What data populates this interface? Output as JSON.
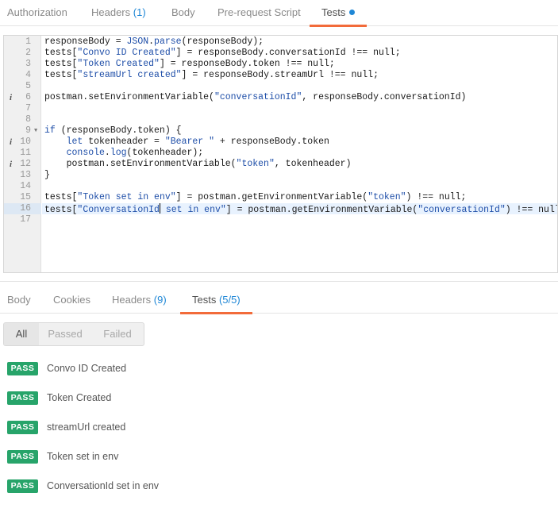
{
  "request_tabs": [
    {
      "label": "Authorization",
      "count": ""
    },
    {
      "label": "Headers",
      "count": "(1)"
    },
    {
      "label": "Body",
      "count": ""
    },
    {
      "label": "Pre-request Script",
      "count": ""
    },
    {
      "label": "Tests",
      "count": "",
      "active": true,
      "modified_dot": true
    }
  ],
  "editor": {
    "lines": [
      {
        "num": "1",
        "info": false,
        "fold": false,
        "text": "responseBody = JSON.parse(responseBody);"
      },
      {
        "num": "2",
        "info": false,
        "fold": false,
        "text": "tests[\"Convo ID Created\"] = responseBody.conversationId !== null;"
      },
      {
        "num": "3",
        "info": false,
        "fold": false,
        "text": "tests[\"Token Created\"] = responseBody.token !== null;"
      },
      {
        "num": "4",
        "info": false,
        "fold": false,
        "text": "tests[\"streamUrl created\"] = responseBody.streamUrl !== null;"
      },
      {
        "num": "5",
        "info": false,
        "fold": false,
        "text": ""
      },
      {
        "num": "6",
        "info": true,
        "fold": false,
        "text": "postman.setEnvironmentVariable(\"conversationId\", responseBody.conversationId)"
      },
      {
        "num": "7",
        "info": false,
        "fold": false,
        "text": ""
      },
      {
        "num": "8",
        "info": false,
        "fold": false,
        "text": ""
      },
      {
        "num": "9",
        "info": false,
        "fold": true,
        "text": "if (responseBody.token) {"
      },
      {
        "num": "10",
        "info": true,
        "fold": false,
        "text": "    let tokenheader = \"Bearer \" + responseBody.token"
      },
      {
        "num": "11",
        "info": false,
        "fold": false,
        "text": "    console.log(tokenheader);"
      },
      {
        "num": "12",
        "info": true,
        "fold": false,
        "text": "    postman.setEnvironmentVariable(\"token\", tokenheader)"
      },
      {
        "num": "13",
        "info": false,
        "fold": false,
        "text": "}"
      },
      {
        "num": "14",
        "info": false,
        "fold": false,
        "text": ""
      },
      {
        "num": "15",
        "info": false,
        "fold": false,
        "text": "tests[\"Token set in env\"] = postman.getEnvironmentVariable(\"token\") !== null;"
      },
      {
        "num": "16",
        "info": false,
        "fold": false,
        "text": "tests[\"ConversationId set in env\"] = postman.getEnvironmentVariable(\"conversationId\") !== null;",
        "highlight": true
      },
      {
        "num": "17",
        "info": false,
        "fold": false,
        "text": ""
      }
    ]
  },
  "response_tabs": [
    {
      "label": "Body",
      "count": ""
    },
    {
      "label": "Cookies",
      "count": ""
    },
    {
      "label": "Headers",
      "count": "(9)"
    },
    {
      "label": "Tests",
      "count": "(5/5)",
      "active": true
    }
  ],
  "filter": {
    "options": [
      "All",
      "Passed",
      "Failed"
    ],
    "selected": "All"
  },
  "results": [
    {
      "status": "PASS",
      "name": "Convo ID Created"
    },
    {
      "status": "PASS",
      "name": "Token Created"
    },
    {
      "status": "PASS",
      "name": "streamUrl created"
    },
    {
      "status": "PASS",
      "name": "Token set in env"
    },
    {
      "status": "PASS",
      "name": "ConversationId set in env"
    }
  ],
  "colors": {
    "accent": "#f26b3a",
    "link": "#1f87d6",
    "pass": "#27a46a"
  }
}
